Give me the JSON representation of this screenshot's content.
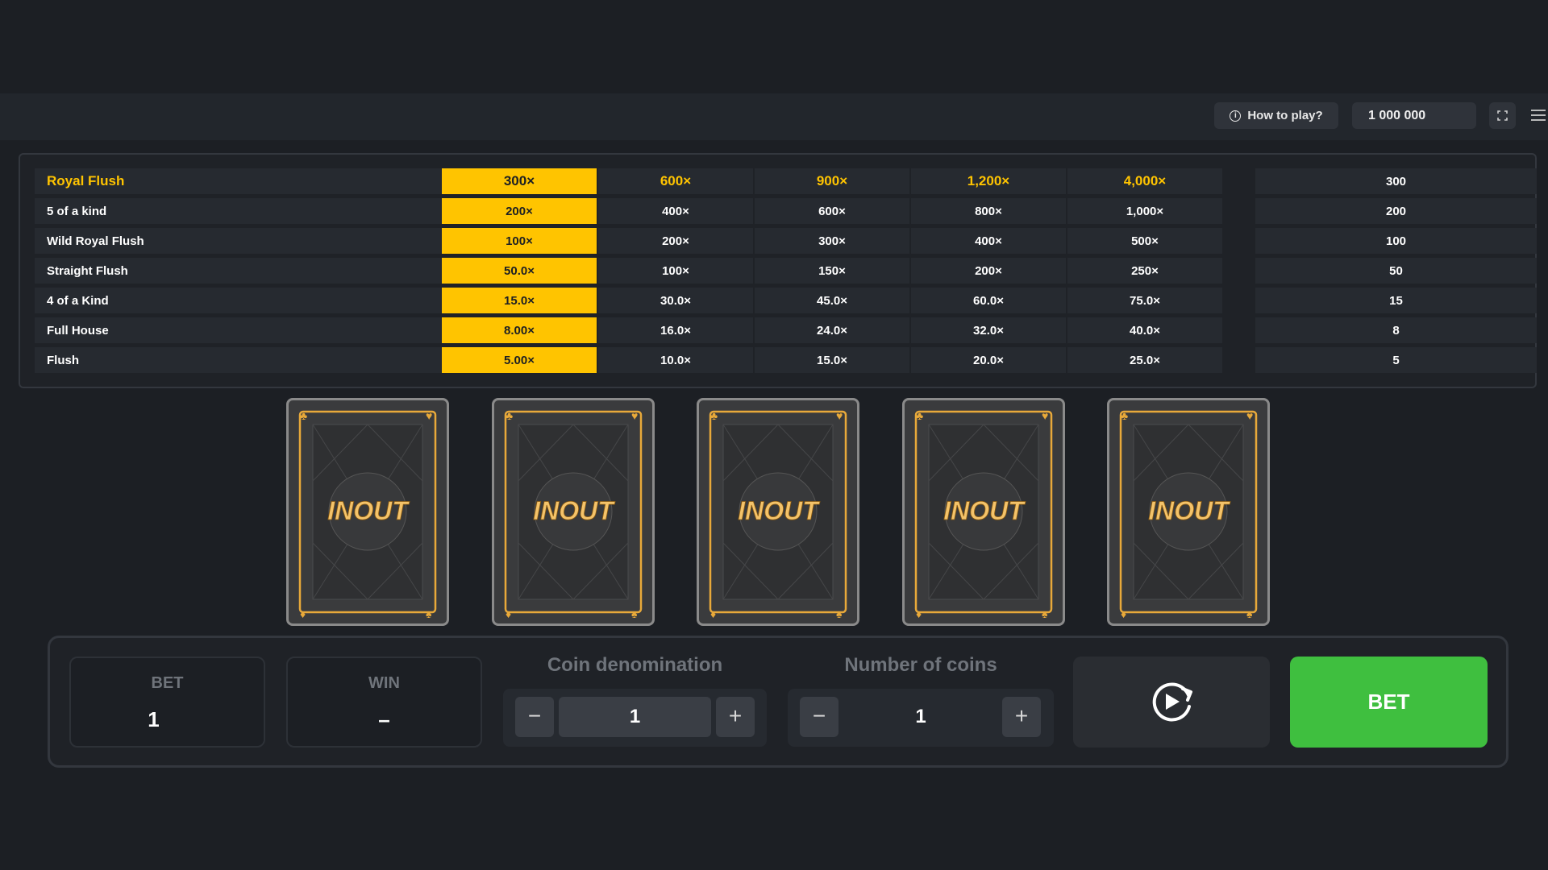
{
  "header": {
    "how_to_play": "How to play?",
    "balance": "1 000 000"
  },
  "paytable": {
    "rows": [
      {
        "name": "Royal Flush",
        "mults": [
          "300×",
          "600×",
          "900×",
          "1,200×",
          "4,000×"
        ],
        "payout": "300"
      },
      {
        "name": "5 of a kind",
        "mults": [
          "200×",
          "400×",
          "600×",
          "800×",
          "1,000×"
        ],
        "payout": "200"
      },
      {
        "name": "Wild Royal Flush",
        "mults": [
          "100×",
          "200×",
          "300×",
          "400×",
          "500×"
        ],
        "payout": "100"
      },
      {
        "name": "Straight Flush",
        "mults": [
          "50.0×",
          "100×",
          "150×",
          "200×",
          "250×"
        ],
        "payout": "50"
      },
      {
        "name": "4 of a Kind",
        "mults": [
          "15.0×",
          "30.0×",
          "45.0×",
          "60.0×",
          "75.0×"
        ],
        "payout": "15"
      },
      {
        "name": "Full House",
        "mults": [
          "8.00×",
          "16.0×",
          "24.0×",
          "32.0×",
          "40.0×"
        ],
        "payout": "8"
      },
      {
        "name": "Flush",
        "mults": [
          "5.00×",
          "10.0×",
          "15.0×",
          "20.0×",
          "25.0×"
        ],
        "payout": "5"
      }
    ],
    "selected_column": 0
  },
  "cards": {
    "count": 5,
    "logo_text": "INOUT",
    "accent": "#e8a93a"
  },
  "controls": {
    "bet_label": "BET",
    "bet_value": "1",
    "win_label": "WIN",
    "win_value": "–",
    "coin_denom_label": "Coin denomination",
    "coin_denom_value": "1",
    "num_coins_label": "Number of coins",
    "num_coins_value": "1",
    "minus": "−",
    "plus": "+",
    "bet_button": "BET"
  },
  "colors": {
    "accent_yellow": "#ffc400",
    "bet_green": "#3fbf3f",
    "background": "#1c1f24"
  }
}
